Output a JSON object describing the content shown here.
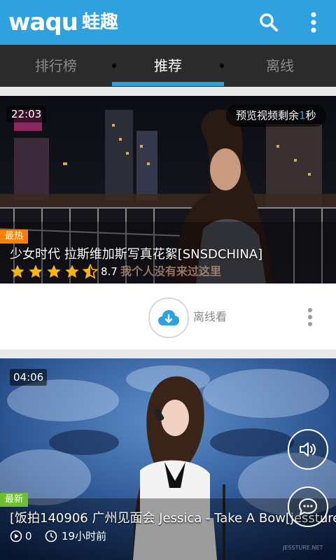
{
  "header": {
    "logo_en": "waqu",
    "logo_cn": "蛙趣"
  },
  "tabs": [
    {
      "label": "排行榜",
      "active": false
    },
    {
      "label": "推荐",
      "active": true
    },
    {
      "label": "离线",
      "active": false
    }
  ],
  "video1": {
    "duration": "22:03",
    "preview_prefix": "预览视频剩余",
    "preview_count": "1",
    "preview_suffix": "秒",
    "badge": "最热",
    "title": "少女时代 拉斯维加斯写真花絮[SNSDCHINA]",
    "rating": "8.7",
    "rating_stars": 4.5,
    "subtitle": "我个人没有来过这里",
    "offline_label": "离线看"
  },
  "video2": {
    "duration": "04:06",
    "badge": "最新",
    "title": "[饭拍140906 广州见面会 Jessica - Take A Bow[jessture]",
    "plays": "0",
    "time_ago": "19小时前",
    "watermark": "JESSTURE.NET"
  },
  "colors": {
    "accent": "#2ea1de",
    "hot": "#ff7f00",
    "new": "#6cbf2e",
    "star": "#ffb400"
  }
}
